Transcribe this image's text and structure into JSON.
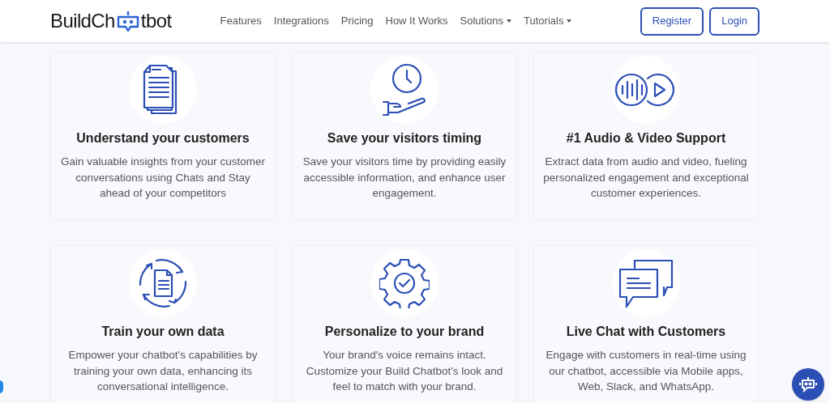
{
  "logo": {
    "before": "BuildCh",
    "after": "tbot"
  },
  "nav": [
    {
      "label": "Features",
      "dropdown": false
    },
    {
      "label": "Integrations",
      "dropdown": false
    },
    {
      "label": "Pricing",
      "dropdown": false
    },
    {
      "label": "How It Works",
      "dropdown": false
    },
    {
      "label": "Solutions",
      "dropdown": true
    },
    {
      "label": "Tutorials",
      "dropdown": true
    }
  ],
  "buttons": [
    "Register",
    "Login"
  ],
  "features": [
    {
      "kind": "documents",
      "title": "Understand your customers",
      "text": "Gain valuable insights from your customer conversations using Chats and Stay ahead of your competitors"
    },
    {
      "kind": "time",
      "title": "Save your visitors timing",
      "text": "Save your visitors time by providing easily accessible information, and enhance user engagement."
    },
    {
      "kind": "media",
      "title": "#1 Audio & Video Support",
      "text": "Extract data from audio and video, fueling personalized engagement and exceptional customer experiences."
    },
    {
      "kind": "training",
      "title": "Train your own data",
      "text": "Empower your chatbot's capabilities by training your own data, enhancing its conversational intelligence."
    },
    {
      "kind": "brand",
      "title": "Personalize to your brand",
      "text": "Your brand's voice remains intact. Customize your Build Chatbot's look and feel to match with your brand."
    },
    {
      "kind": "chat",
      "title": "Live Chat with Customers",
      "text": "Engage with customers in real-time using our chatbot, accessible via Mobile apps, Web, Slack, and WhatsApp."
    }
  ]
}
